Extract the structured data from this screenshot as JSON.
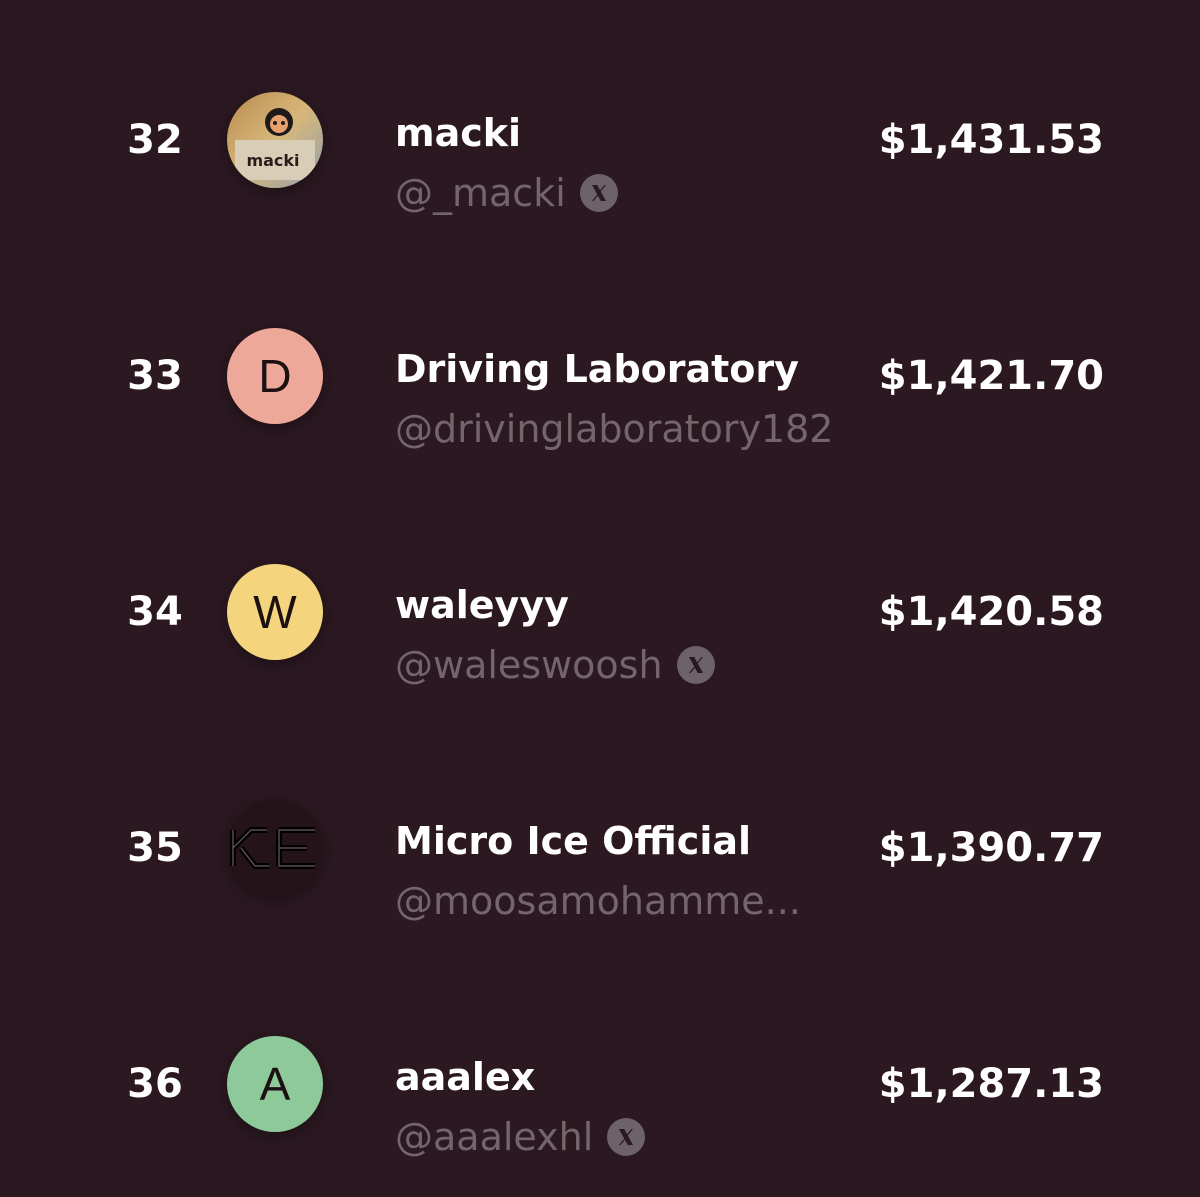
{
  "leaderboard": {
    "rows": [
      {
        "rank": "32",
        "name": "macki",
        "handle": "@_macki",
        "amount": "$1,431.53",
        "has_x": true,
        "avatar_type": "image",
        "avatar_text": "macki",
        "avatar_icon": "macki-image-avatar"
      },
      {
        "rank": "33",
        "name": "Driving Laboratory",
        "handle": "@drivinglaboratory182",
        "amount": "$1,421.70",
        "has_x": false,
        "avatar_type": "letter",
        "avatar_letter": "D",
        "avatar_color": "#eea899"
      },
      {
        "rank": "34",
        "name": "waleyyy",
        "handle": "@waleswoosh",
        "amount": "$1,420.58",
        "has_x": true,
        "avatar_type": "letter",
        "avatar_letter": "W",
        "avatar_color": "#f4d57e"
      },
      {
        "rank": "35",
        "name": "Micro Ice Official",
        "handle": "@moosamohamme...",
        "amount": "$1,390.77",
        "has_x": false,
        "avatar_type": "logo",
        "avatar_text": "ICE",
        "avatar_icon": "micro-ice-logo"
      },
      {
        "rank": "36",
        "name": "aaalex",
        "handle": "@aaalexhl",
        "amount": "$1,287.13",
        "has_x": true,
        "avatar_type": "letter",
        "avatar_letter": "A",
        "avatar_color": "#8dc999"
      }
    ]
  },
  "colors": {
    "background": "#2b1821",
    "handle_text": "#73656b",
    "x_badge": "#6d6268"
  },
  "icons": {
    "x_badge": "x-logo-icon"
  }
}
